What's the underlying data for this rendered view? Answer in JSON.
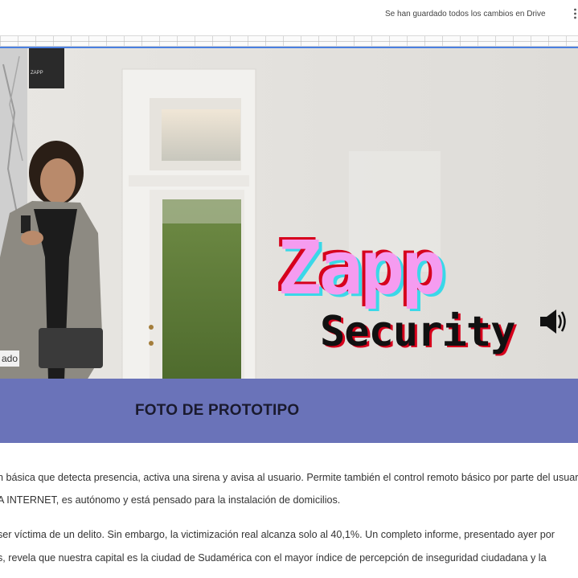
{
  "toolbar": {
    "save_status": "Se han guardado todos los cambios en Drive"
  },
  "image": {
    "camera_label": "ZAPP",
    "left_caption": "ado",
    "logo_line1": "Zapp",
    "logo_line2": "Security"
  },
  "caption_banner": {
    "text": "FOTO DE PROTOTIPO",
    "color": "#6a73b9"
  },
  "body_text": {
    "line1": "n básica que detecta presencia, activa una sirena y avisa al usuario. Permite también el control remoto básico por parte del usuario. El",
    "line2": "A INTERNET, es autónomo y está pensado para la instalación de domicilios.",
    "line3": "ser víctima de un delito. Sin embargo, la victimización real alcanza solo al 40,1%.  Un completo informe, presentado ayer por",
    "line4": "s, revela que nuestra capital es la ciudad de Sudamérica con el mayor índice de percepción de inseguridad ciudadana y la"
  },
  "icons": {
    "menu": "more-vert-icon",
    "speaker": "speaker-icon"
  }
}
